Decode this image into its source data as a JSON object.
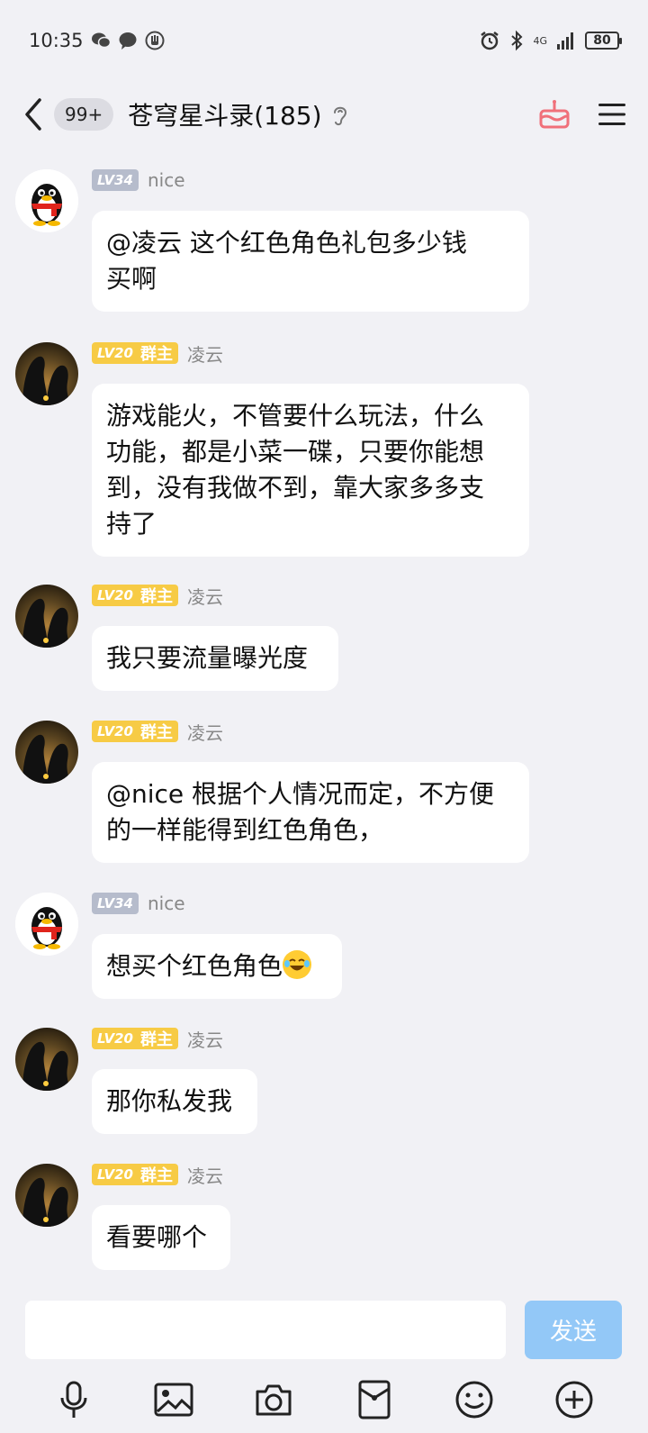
{
  "status_bar": {
    "time": "10:35",
    "battery": "80",
    "network": "4G"
  },
  "header": {
    "unread_badge": "99+",
    "title": "苍穹星斗录(185)"
  },
  "messages": [
    {
      "sender": "nice",
      "level": "LV34",
      "role": "",
      "avatar": "qq-penguin",
      "text": "@凌云 这个红色角色礼包多少钱买啊",
      "lines": [
        "@凌云 这个红色角色礼包多少钱",
        "买啊"
      ]
    },
    {
      "sender": "凌云",
      "level": "LV20",
      "role": "群主",
      "avatar": "penguin-silhouette",
      "text": "游戏能火，不管要什么玩法，什么功能，都是小菜一碟，只要你能想到，没有我做不到，靠大家多多支持了",
      "lines": [
        "游戏能火，不管要什么玩法，什么",
        "功能，都是小菜一碟，只要你能想",
        "到，没有我做不到，靠大家多多支",
        "持了"
      ]
    },
    {
      "sender": "凌云",
      "level": "LV20",
      "role": "群主",
      "avatar": "penguin-silhouette",
      "text": "我只要流量曝光度",
      "lines": [
        "我只要流量曝光度"
      ]
    },
    {
      "sender": "凌云",
      "level": "LV20",
      "role": "群主",
      "avatar": "penguin-silhouette",
      "text": "@nice 根据个人情况而定，不方便的一样能得到红色角色，",
      "lines": [
        "@nice 根据个人情况而定，不方便",
        "的一样能得到红色角色，"
      ]
    },
    {
      "sender": "nice",
      "level": "LV34",
      "role": "",
      "avatar": "qq-penguin",
      "text": "想买个红色角色",
      "lines": [
        "想买个红色角色"
      ],
      "emoji": "tears-of-joy"
    },
    {
      "sender": "凌云",
      "level": "LV20",
      "role": "群主",
      "avatar": "penguin-silhouette",
      "text": "那你私发我",
      "lines": [
        "那你私发我"
      ]
    },
    {
      "sender": "凌云",
      "level": "LV20",
      "role": "群主",
      "avatar": "penguin-silhouette",
      "text": "看要哪个",
      "lines": [
        "看要哪个"
      ]
    }
  ],
  "input": {
    "placeholder": "",
    "send_label": "发送"
  },
  "toolbar": [
    "microphone-icon",
    "image-icon",
    "camera-icon",
    "red-packet-icon",
    "emoji-icon",
    "plus-icon"
  ],
  "colors": {
    "background": "#f1f1f5",
    "send_button": "#93c8f7",
    "owner_badge": "#f7cb45",
    "level_badge": "#b6bccc"
  }
}
